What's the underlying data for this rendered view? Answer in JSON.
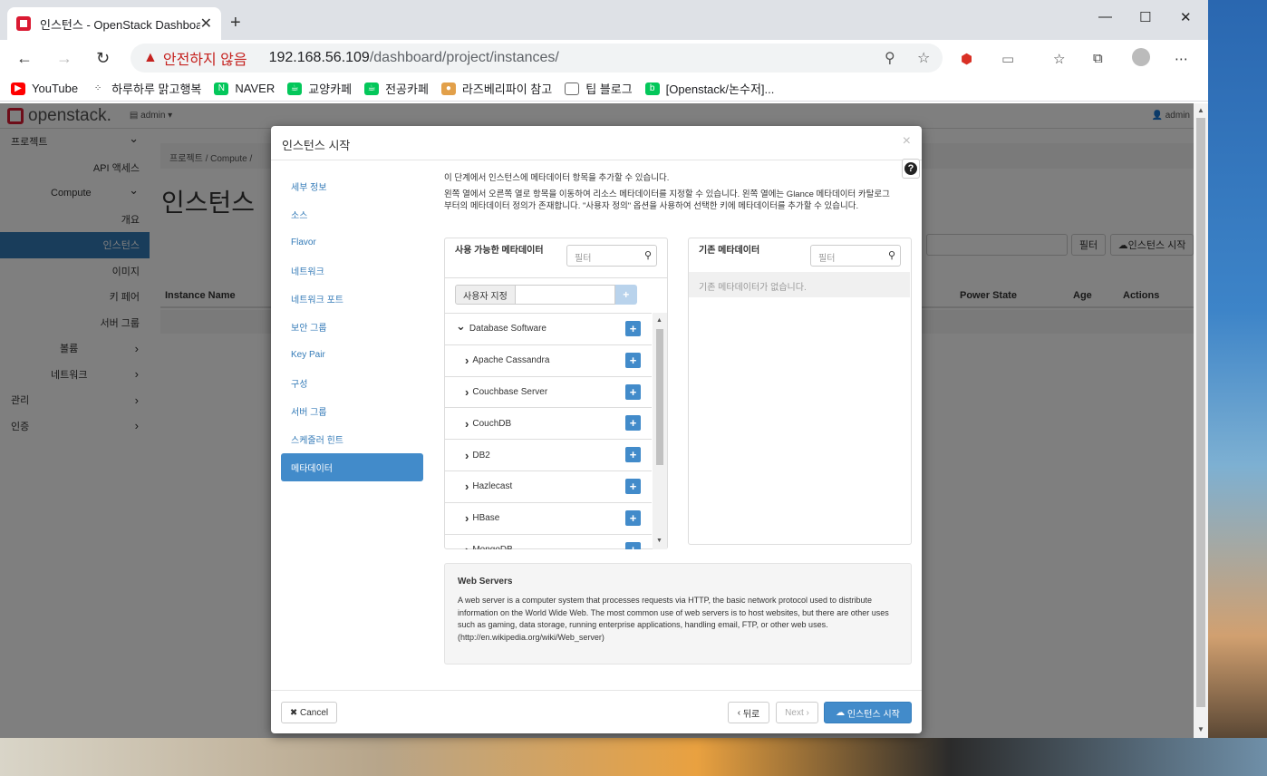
{
  "browser": {
    "tab_title": "인스턴스 - OpenStack Dashboard",
    "security_warning": "안전하지 않음",
    "url_host": "192.168.56.109",
    "url_path": "/dashboard/project/instances/",
    "bookmarks": [
      {
        "label": "YouTube",
        "color": "#ff0000"
      },
      {
        "label": "하루하루 맑고행복",
        "color": "#333333"
      },
      {
        "label": "NAVER",
        "color": "#03c75a"
      },
      {
        "label": "교양카페",
        "color": "#03c75a"
      },
      {
        "label": "전공카페",
        "color": "#03c75a"
      },
      {
        "label": "라즈베리파이 참고",
        "color": "#e2a04a"
      },
      {
        "label": "팁 블로그",
        "color": "#666666"
      },
      {
        "label": "[Openstack/논수저]...",
        "color": "#03c75a"
      }
    ]
  },
  "app": {
    "logo": "openstack.",
    "project_menu": "admin",
    "user_menu": "admin",
    "sidebar": [
      {
        "label": "프로젝트",
        "indent": 12,
        "chev": "⌄"
      },
      {
        "label": "API 액세스",
        "indent": 0,
        "right": true
      },
      {
        "label": "Compute",
        "indent": 56,
        "chev": "⌄"
      },
      {
        "label": "개요",
        "indent": 0,
        "right": true
      },
      {
        "label": "인스턴스",
        "indent": 0,
        "right": true,
        "active": true
      },
      {
        "label": "이미지",
        "indent": 0,
        "right": true
      },
      {
        "label": "키 페어",
        "indent": 0,
        "right": true
      },
      {
        "label": "서버 그룹",
        "indent": 0,
        "right": true
      },
      {
        "label": "볼륨",
        "indent": 66,
        "chev": "›"
      },
      {
        "label": "네트워크",
        "indent": 56,
        "chev": "›"
      },
      {
        "label": "관리",
        "indent": 12,
        "chev": "›"
      },
      {
        "label": "인증",
        "indent": 12,
        "chev": "›"
      }
    ],
    "breadcrumb": "프로젝트 /   Compute /",
    "page_title": "인스턴스",
    "filter_button": "필터",
    "launch_button": "인스턴스 시작",
    "columns": [
      "Instance Name",
      "Power State",
      "Age",
      "Actions"
    ]
  },
  "modal": {
    "title": "인스턴스 시작",
    "close": "×",
    "help": "?",
    "steps": [
      "세부 정보",
      "소스",
      "Flavor",
      "네트워크",
      "네트워크 포트",
      "보안 그룹",
      "Key Pair",
      "구성",
      "서버 그룹",
      "스케줄러 힌트",
      "메타데이터"
    ],
    "active_step": 10,
    "desc1": "이 단계에서 인스턴스에 메타데이터 항목을 추가할 수 있습니다.",
    "desc2": "왼쪽 열에서 오른쪽 열로 항목을 이동하여 리소스 메타데이터를 지정할 수 있습니다. 왼쪽 열에는 Glance 메타데이터 카탈로그부터의 메타데이터 정의가 존재합니다. \"사용자 정의\" 옵션을 사용하여 선택한 키에 메타데이터를 추가할 수 있습니다.",
    "available": {
      "title": "사용 가능한 메타데이터",
      "filter_placeholder": "필터",
      "custom_label": "사용자 지정",
      "items": [
        {
          "label": "Database Software",
          "expanded": true,
          "child": false
        },
        {
          "label": "Apache Cassandra",
          "child": true
        },
        {
          "label": "Couchbase Server",
          "child": true
        },
        {
          "label": "CouchDB",
          "child": true
        },
        {
          "label": "DB2",
          "child": true
        },
        {
          "label": "Hazlecast",
          "child": true
        },
        {
          "label": "HBase",
          "child": true
        },
        {
          "label": "MongoDB",
          "child": true
        }
      ]
    },
    "existing": {
      "title": "기존 메타데이터",
      "filter_placeholder": "필터",
      "empty": "기존 메타데이터가 없습니다."
    },
    "info_title": "Web Servers",
    "info_text": "A web server is a computer system that processes requests via HTTP, the basic network protocol used to distribute information on the World Wide Web. The most common use of web servers is to host websites, but there are other uses such as gaming, data storage, running enterprise applications, handling email, FTP, or other web uses. (http://en.wikipedia.org/wiki/Web_server)",
    "cancel": "Cancel",
    "back": "뒤로",
    "next": "Next",
    "launch": "인스턴스 시작"
  }
}
